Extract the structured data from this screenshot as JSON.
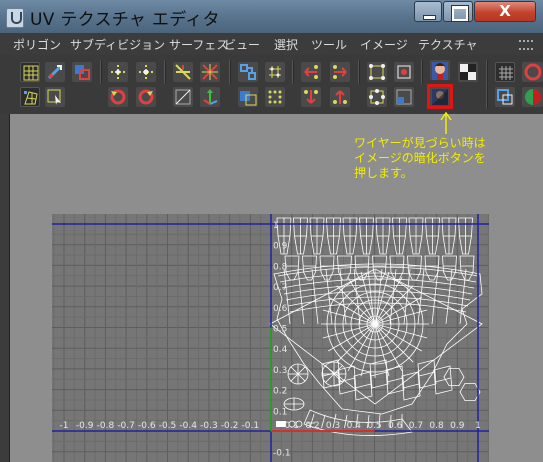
{
  "window": {
    "title": "UV テクスチャ エディタ",
    "minimize": "",
    "maximize": "",
    "close": "X"
  },
  "menu": [
    "ポリゴン",
    "サブディビジョン サーフェス",
    "ビュー",
    "選択",
    "ツール",
    "イメージ",
    "テクスチャ"
  ],
  "annotation": {
    "lines": [
      "ワイヤーが見づらい時は",
      "イメージの暗化ボタンを",
      "押します。"
    ],
    "color": "#f2ed00",
    "box_color": "#e01414"
  },
  "axes": {
    "x_ticks": [
      "-1",
      "-0.9",
      "-0.8",
      "-0.7",
      "-0.6",
      "-0.5",
      "-0.4",
      "-0.3",
      "-0.2",
      "-0.1",
      "0.1",
      "0.2",
      "0.3",
      "0.4",
      "0.5",
      "0.6",
      "0.7",
      "0.8",
      "0.9",
      "1"
    ],
    "y_ticks": [
      "1",
      "0.9",
      "0.8",
      "0.7",
      "0.6",
      "0.5",
      "0.4",
      "0.3",
      "0.2",
      "0.1",
      "-0.1"
    ],
    "u_axis_color": "#d03030",
    "v_axis_color": "#2a9a2a",
    "wire_color": "#ffffff",
    "frame_color": "#2020a0"
  },
  "toolbar": {
    "icons": [
      "grid-icon",
      "uv-flip-icon",
      "uv-rotate-icon",
      "move-left-icon",
      "move-right-icon",
      "cut-uv-icon",
      "sew-uv-icon",
      "layout-icon",
      "grid-snap-icon",
      "pin-left-icon",
      "pin-right-icon",
      "select-shell-icon",
      "shell-border-icon",
      "image-icon",
      "checker-icon",
      "toggle-grid-icon",
      "red-dot-icon",
      "image-dim-icon",
      "isolate-icon",
      "shaded-icon"
    ]
  }
}
